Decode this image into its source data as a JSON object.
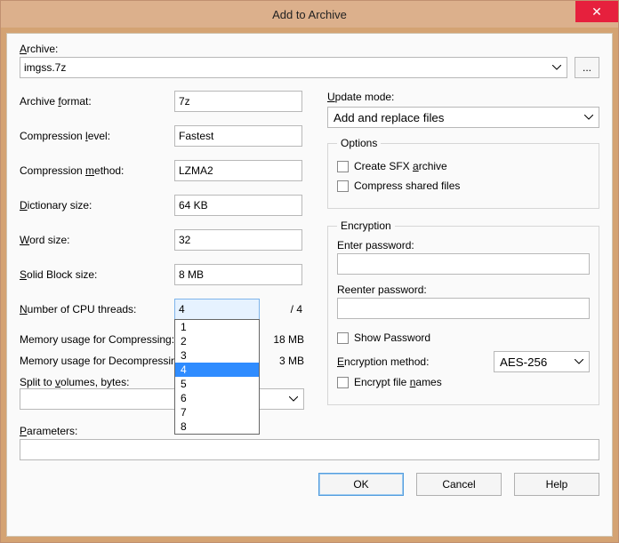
{
  "title": "Add to Archive",
  "archive": {
    "label": "Archive:",
    "value": "imgss.7z",
    "browse_label": "..."
  },
  "left": {
    "format": {
      "label_pre": "Archive ",
      "label_u": "f",
      "label_post": "ormat:",
      "value": "7z"
    },
    "level": {
      "label_pre": "Compression ",
      "label_u": "l",
      "label_post": "evel:",
      "value": "Fastest"
    },
    "method": {
      "label_pre": "Compression ",
      "label_u": "m",
      "label_post": "ethod:",
      "value": "LZMA2"
    },
    "dict": {
      "label_u": "D",
      "label_post": "ictionary size:",
      "value": "64 KB"
    },
    "word": {
      "label_u": "W",
      "label_post": "ord size:",
      "value": "32"
    },
    "block": {
      "label_u": "S",
      "label_post": "olid Block size:",
      "value": "8 MB"
    },
    "cpu": {
      "label_u": "N",
      "label_post": "umber of CPU threads:",
      "value": "4",
      "total": "/ 4",
      "options": [
        "1",
        "2",
        "3",
        "4",
        "5",
        "6",
        "7",
        "8"
      ]
    },
    "mem_comp": {
      "label": "Memory usage for Compressing:",
      "value": "18 MB"
    },
    "mem_decomp": {
      "label": "Memory usage for Decompressing:",
      "value": "3 MB"
    },
    "split": {
      "label_pre": "Split to ",
      "label_u": "v",
      "label_post": "olumes, bytes:",
      "value": ""
    }
  },
  "right": {
    "update": {
      "label_u": "U",
      "label_post": "pdate mode:",
      "value": "Add and replace files"
    },
    "options": {
      "legend": "Options",
      "sfx": {
        "label_pre": "Create SFX ",
        "label_u": "a",
        "label_post": "rchive",
        "checked": false
      },
      "shared": {
        "label_pre": "Compress shared files",
        "checked": false
      }
    },
    "encryption": {
      "legend": "Encryption",
      "enter": {
        "label": "Enter password:"
      },
      "reenter": {
        "label": "Reenter password:"
      },
      "show": {
        "label": "Show Password",
        "checked": false
      },
      "method": {
        "label_u": "E",
        "label_post": "ncryption method:",
        "value": "AES-256"
      },
      "encfn": {
        "label_pre": "Encrypt file ",
        "label_u": "n",
        "label_post": "ames",
        "checked": false
      }
    }
  },
  "params": {
    "label_u": "P",
    "label_post": "arameters:",
    "value": ""
  },
  "buttons": {
    "ok": "OK",
    "cancel": "Cancel",
    "help": "Help"
  }
}
